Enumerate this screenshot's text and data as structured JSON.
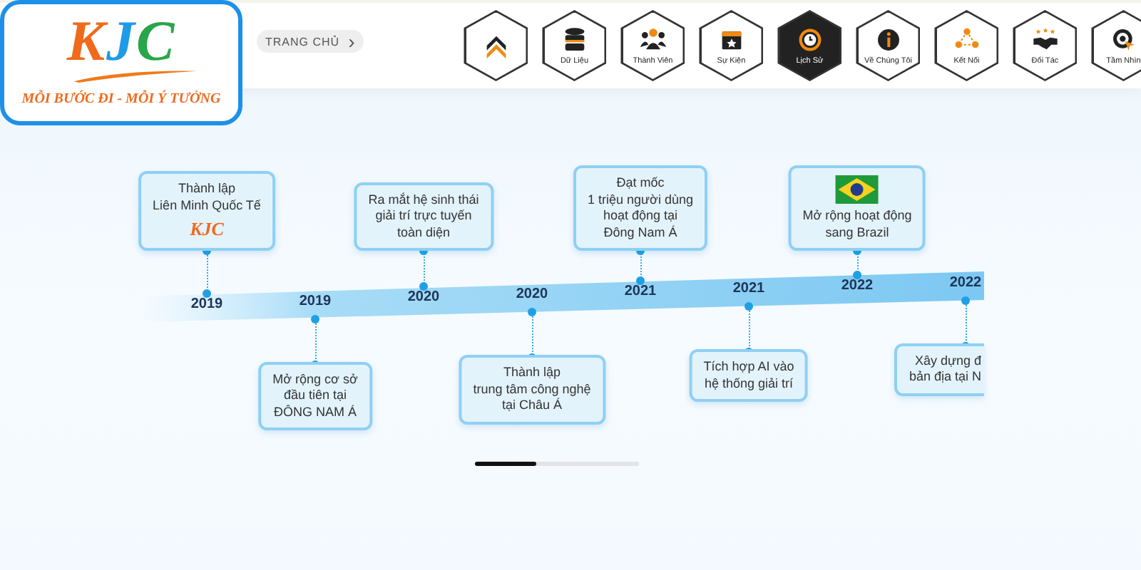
{
  "logo": {
    "letters": [
      "K",
      "J",
      "C"
    ],
    "slogan": "MỖI BƯỚC ĐI - MỖI Ý TƯỞNG"
  },
  "breadcrumb": {
    "label": "TRANG CHỦ",
    "arrow": "›"
  },
  "nav": [
    {
      "selected": false
    },
    {
      "label": "Dữ Liệu",
      "selected": false
    },
    {
      "label": "Thành Viên",
      "selected": false
    },
    {
      "label": "Sự Kiện",
      "selected": false
    },
    {
      "label": "Lịch Sử",
      "selected": true
    },
    {
      "label": "Về Chúng Tôi",
      "selected": false
    },
    {
      "label": "Kết Nối",
      "selected": false
    },
    {
      "label": "Đối Tác",
      "selected": false
    },
    {
      "label": "Tầm Nhìn",
      "selected": false
    }
  ],
  "timeline": [
    {
      "year": "2019",
      "kind": "above",
      "lines": [
        "Thành lập",
        "Liên Minh Quốc Tế"
      ],
      "media": {
        "kind": "logo",
        "text": "KJC"
      }
    },
    {
      "year": "2019",
      "kind": "below",
      "lines": [
        "Mở rộng cơ sở",
        "đầu tiên tại",
        "ĐÔNG NAM Á"
      ]
    },
    {
      "year": "2020",
      "kind": "above",
      "lines": [
        "Ra mắt hệ sinh thái",
        "giải trí trực tuyến",
        "toàn diện"
      ]
    },
    {
      "year": "2020",
      "kind": "below",
      "lines": [
        "Thành lập",
        "trung tâm công nghệ",
        "tại Châu Á"
      ]
    },
    {
      "year": "2021",
      "kind": "above",
      "lines": [
        "Đạt mốc",
        "1 triệu người dùng",
        "hoạt động tại",
        "Đông Nam Á"
      ]
    },
    {
      "year": "2021",
      "kind": "below",
      "lines": [
        "Tích hợp AI vào",
        "hệ thống giải trí"
      ]
    },
    {
      "year": "2022",
      "kind": "above",
      "lines": [
        "Mở rộng hoạt động",
        "sang Brazil"
      ],
      "media": {
        "kind": "flag"
      }
    },
    {
      "year": "2022",
      "kind": "below",
      "lines": [
        "Xây dựng đ",
        "bản địa tại N"
      ],
      "clipped": true
    }
  ]
}
